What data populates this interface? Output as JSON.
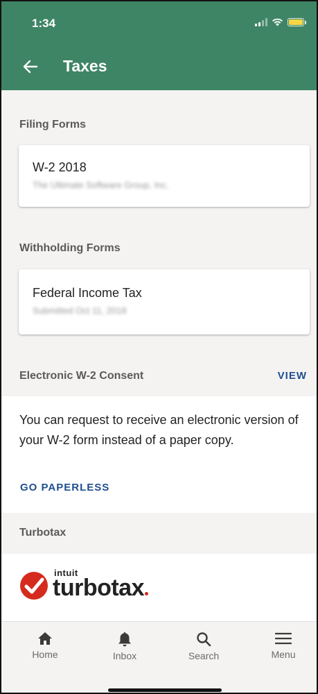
{
  "status_bar": {
    "time": "1:34"
  },
  "header": {
    "title": "Taxes"
  },
  "filing": {
    "section_label": "Filing Forms",
    "card_title": "W-2 2018",
    "card_subtitle": "The Ultimate Software Group, Inc."
  },
  "withholding": {
    "section_label": "Withholding Forms",
    "card_title": "Federal Income Tax",
    "card_subtitle": "Submitted Oct 11, 2018"
  },
  "consent": {
    "section_label": "Electronic W-2 Consent",
    "view_label": "VIEW",
    "body": "You can request to receive an electronic version of your W-2 form instead of a paper copy.",
    "action_label": "GO PAPERLESS"
  },
  "turbotax": {
    "section_label": "Turbotax",
    "logo_intuit": "intuit",
    "logo_wordmark": "turbotax",
    "brand_color": "#d52b1e"
  },
  "bottom_nav": {
    "items": [
      {
        "label": "Home",
        "icon": "home-icon"
      },
      {
        "label": "Inbox",
        "icon": "bell-icon"
      },
      {
        "label": "Search",
        "icon": "search-icon"
      },
      {
        "label": "Menu",
        "icon": "menu-icon"
      }
    ]
  },
  "colors": {
    "header": "#3e8565",
    "link": "#1f4e8f",
    "background": "#f4f3f2"
  }
}
